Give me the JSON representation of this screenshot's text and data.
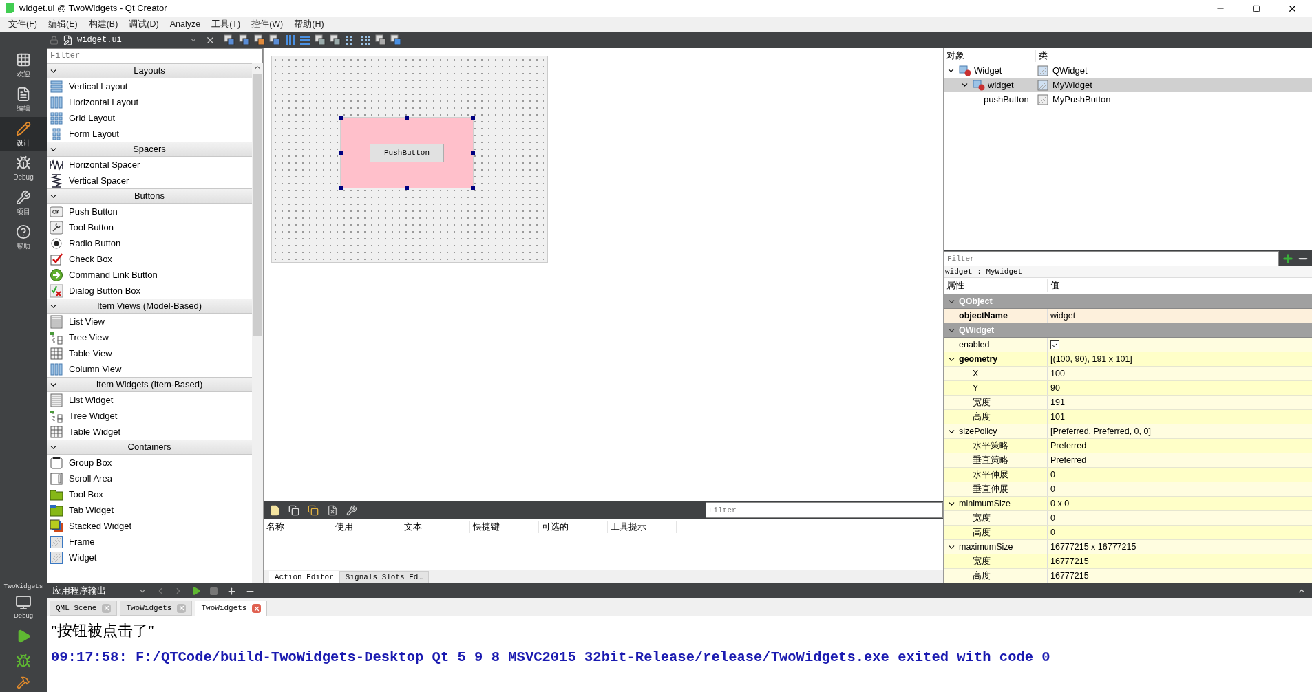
{
  "window": {
    "title": "widget.ui @ TwoWidgets - Qt Creator"
  },
  "menu": [
    "文件(F)",
    "编辑(E)",
    "构建(B)",
    "调试(D)",
    "Analyze",
    "工具(T)",
    "控件(W)",
    "帮助(H)"
  ],
  "editor_toolbar": {
    "file": "widget.ui"
  },
  "modes": [
    {
      "label": "欢迎",
      "selected": false
    },
    {
      "label": "编辑",
      "selected": false
    },
    {
      "label": "设计",
      "selected": true
    },
    {
      "label": "Debug",
      "selected": false
    },
    {
      "label": "项目",
      "selected": false
    },
    {
      "label": "帮助",
      "selected": false
    }
  ],
  "target": {
    "project": "TwoWidgets",
    "build": "Debug"
  },
  "widget_box": {
    "placeholder": "Filter",
    "sections": [
      {
        "title": "Layouts",
        "expanded": true,
        "items": [
          "Vertical Layout",
          "Horizontal Layout",
          "Grid Layout",
          "Form Layout"
        ]
      },
      {
        "title": "Spacers",
        "expanded": true,
        "items": [
          "Horizontal Spacer",
          "Vertical Spacer"
        ]
      },
      {
        "title": "Buttons",
        "expanded": true,
        "items": [
          "Push Button",
          "Tool Button",
          "Radio Button",
          "Check Box",
          "Command Link Button",
          "Dialog Button Box"
        ]
      },
      {
        "title": "Item Views (Model-Based)",
        "expanded": true,
        "items": [
          "List View",
          "Tree View",
          "Table View",
          "Column View"
        ]
      },
      {
        "title": "Item Widgets (Item-Based)",
        "expanded": true,
        "items": [
          "List Widget",
          "Tree Widget",
          "Table Widget"
        ]
      },
      {
        "title": "Containers",
        "expanded": true,
        "items": [
          "Group Box",
          "Scroll Area",
          "Tool Box",
          "Tab Widget",
          "Stacked Widget",
          "Frame",
          "Widget"
        ]
      }
    ]
  },
  "form": {
    "button_text": "PushButton",
    "widget_selected": true
  },
  "action_editor": {
    "placeholder": "Filter",
    "columns": [
      "名称",
      "使用",
      "文本",
      "快捷键",
      "可选的",
      "工具提示"
    ],
    "tabs": [
      {
        "label": "Action Editor",
        "selected": true
      },
      {
        "label": "Signals  Slots Ed…",
        "selected": false
      }
    ]
  },
  "object_inspector": {
    "columns": [
      "对象",
      "类"
    ],
    "tree": [
      {
        "name": "Widget",
        "class": "QWidget",
        "expanded": true,
        "selected": false,
        "children": [
          {
            "name": "widget",
            "class": "MyWidget",
            "expanded": true,
            "selected": true,
            "children": [
              {
                "name": "pushButton",
                "class": "MyPushButton",
                "selected": false
              }
            ]
          }
        ]
      }
    ]
  },
  "property_editor": {
    "placeholder": "Filter",
    "subject": "widget : MyWidget",
    "columns": [
      "属性",
      "值"
    ],
    "groups": [
      {
        "name": "QObject",
        "expanded": true,
        "properties": [
          {
            "name": "objectName",
            "value": "widget",
            "modified": true
          }
        ]
      },
      {
        "name": "QWidget",
        "expanded": true,
        "properties": [
          {
            "name": "enabled",
            "kind": "checkbox",
            "checked": true,
            "modified": false
          },
          {
            "name": "geometry",
            "value": "[(100, 90), 191 x 101]",
            "modified": true,
            "expanded": true,
            "children": [
              {
                "name": "X",
                "value": "100"
              },
              {
                "name": "Y",
                "value": "90"
              },
              {
                "name": "宽度",
                "value": "191"
              },
              {
                "name": "高度",
                "value": "101"
              }
            ]
          },
          {
            "name": "sizePolicy",
            "value": "[Preferred, Preferred, 0, 0]",
            "modified": false,
            "expanded": true,
            "children": [
              {
                "name": "水平策略",
                "value": "Preferred"
              },
              {
                "name": "垂直策略",
                "value": "Preferred"
              },
              {
                "name": "水平伸展",
                "value": "0"
              },
              {
                "name": "垂直伸展",
                "value": "0"
              }
            ]
          },
          {
            "name": "minimumSize",
            "value": "0 x 0",
            "modified": false,
            "expanded": true,
            "children": [
              {
                "name": "宽度",
                "value": "0"
              },
              {
                "name": "高度",
                "value": "0"
              }
            ]
          },
          {
            "name": "maximumSize",
            "value": "16777215 x 16777215",
            "modified": false,
            "expanded": true,
            "children": [
              {
                "name": "宽度",
                "value": "16777215"
              },
              {
                "name": "高度",
                "value": "16777215"
              }
            ]
          }
        ]
      }
    ]
  },
  "output_pane": {
    "title": "应用程序输出",
    "tabs": [
      {
        "label": "QML Scene",
        "selected": false
      },
      {
        "label": "TwoWidgets",
        "selected": false
      },
      {
        "label": "TwoWidgets",
        "selected": true
      }
    ],
    "lines": [
      {
        "kind": "message",
        "text": "\"按钮被点击了\""
      },
      {
        "kind": "status",
        "text": "09:17:58: F:/QTCode/build-TwoWidgets-Desktop_Qt_5_9_8_MSVC2015_32bit-Release/release/TwoWidgets.exe exited with code 0"
      }
    ]
  }
}
